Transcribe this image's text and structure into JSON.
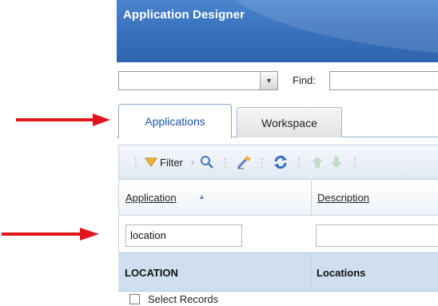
{
  "app": {
    "title": "Application Designer"
  },
  "findbar": {
    "combo_value": "",
    "find_label": "Find:",
    "find_value": ""
  },
  "tabs": [
    {
      "label": "Applications",
      "active": true
    },
    {
      "label": "Workspace",
      "active": false
    }
  ],
  "toolbar": {
    "filter_label": "Filter",
    "icons": [
      "filter-icon",
      "chevron-right-icon",
      "magnifier-icon",
      "eraser-icon",
      "refresh-icon",
      "arrow-up-icon",
      "arrow-down-icon"
    ]
  },
  "table": {
    "columns": [
      {
        "label": "Application",
        "sort": "ascending"
      },
      {
        "label": "Description"
      }
    ],
    "filters": {
      "application": "location",
      "description": ""
    },
    "rows": [
      {
        "application": "LOCATION",
        "description": "Locations"
      }
    ],
    "select_records_label": "Select Records"
  },
  "annotations": {
    "arrow_color": "#e0161c"
  }
}
